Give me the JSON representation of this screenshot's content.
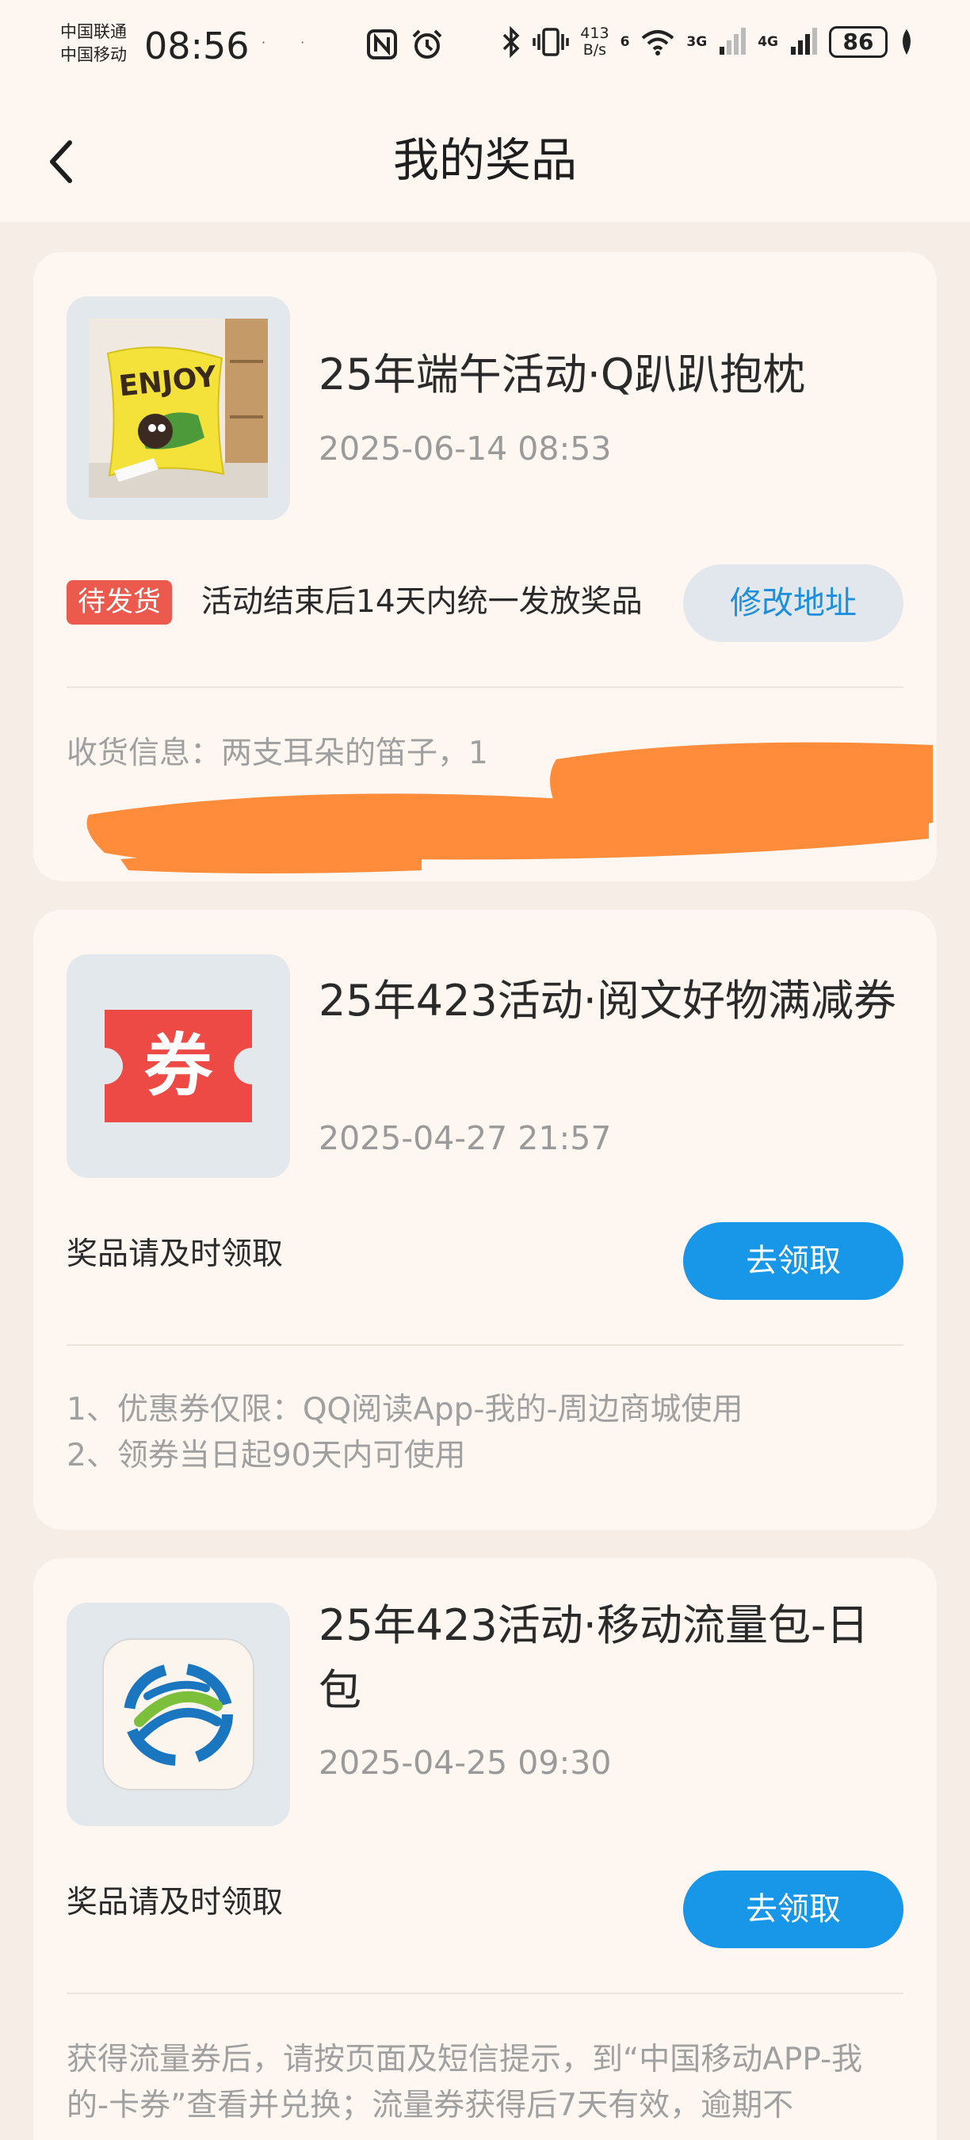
{
  "status_bar": {
    "carrier_1": "中国联通",
    "carrier_2": "中国移动",
    "time": "08:56",
    "net_speed_value": "413",
    "net_speed_unit": "B/s",
    "wifi_label": "6",
    "signal_1_label": "3G",
    "signal_2_label": "4G",
    "battery": "86"
  },
  "nav": {
    "title": "我的奖品"
  },
  "prizes": [
    {
      "title": "25年端午活动·Q趴趴抱枕",
      "date": "2025-06-14 08:53",
      "thumbnail_icon": "pillow-image",
      "pillow_text": "ENJOY",
      "status_badge": "待发货",
      "status_note": "活动结束后14天内统一发放奖品",
      "action_label": "修改地址",
      "shipping_info": "收货信息：两支耳朵的笛子，1"
    },
    {
      "title": "25年423活动·阅文好物满减券",
      "date": "2025-04-27 21:57",
      "thumbnail_icon": "coupon-icon",
      "coupon_text": "券",
      "note": "奖品请及时领取",
      "action_label": "去领取",
      "rules": [
        "1、优惠券仅限：QQ阅读App-我的-周边商城使用",
        "2、领券当日起90天内可使用"
      ]
    },
    {
      "title": "25年423活动·移动流量包-日包",
      "date": "2025-04-25 09:30",
      "thumbnail_icon": "china-mobile-logo",
      "note": "奖品请及时领取",
      "action_label": "去领取",
      "description": "获得流量券后，请按页面及短信提示，到“中国移动APP-我的-卡券”查看并兑换；流量券获得后7天有效，逾期不"
    }
  ],
  "colors": {
    "page_bg": "#f5ede6",
    "card_bg": "#fdf6f1",
    "accent_blue": "#1896e8",
    "badge_red": "#ec5a4e",
    "redaction_orange": "#ff8c3a"
  }
}
